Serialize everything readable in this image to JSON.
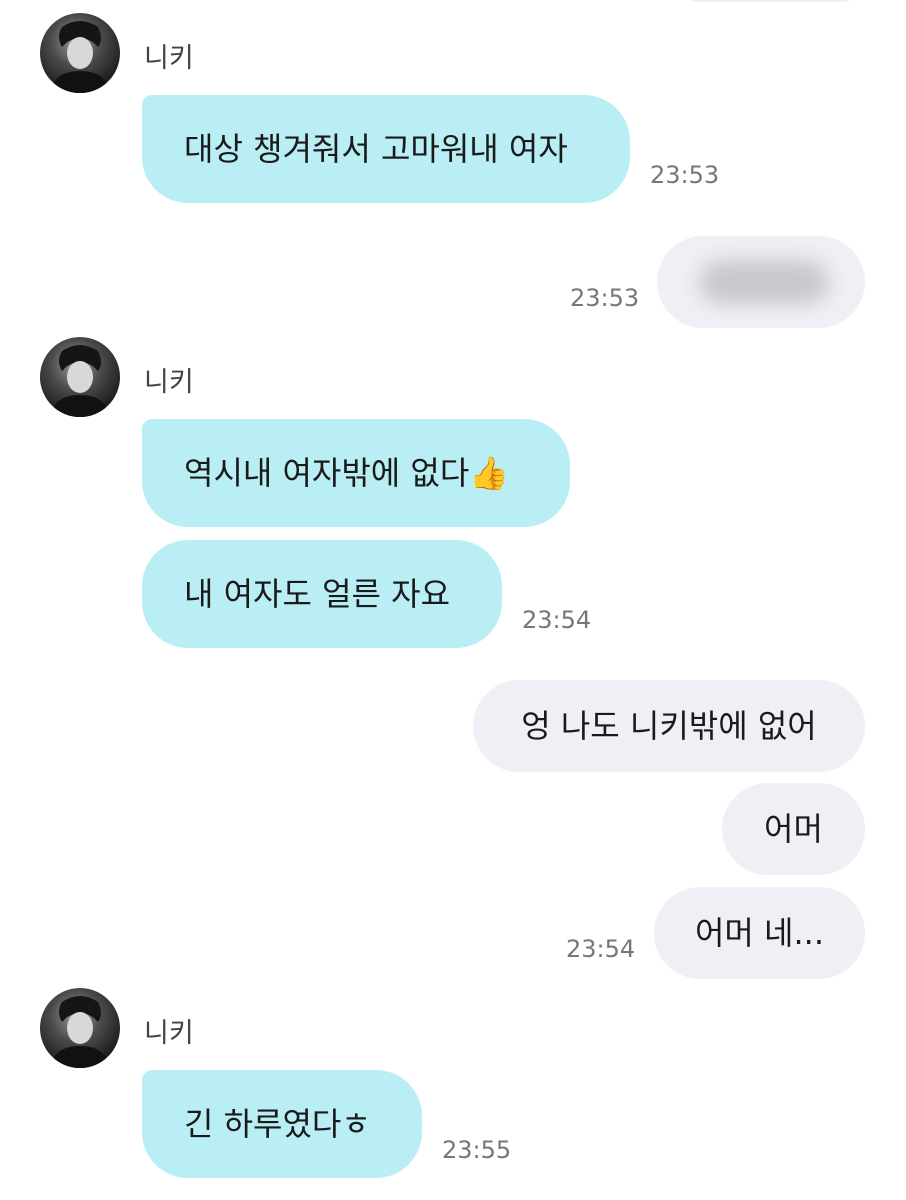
{
  "contact": {
    "name": "니키"
  },
  "messages": [
    {
      "text": "대상 챙겨줘서 고마워내 여자",
      "time": "23:53"
    },
    {
      "time": "23:53"
    },
    {
      "text": "역시내 여자밖에 없다",
      "emoji": "👍"
    },
    {
      "text": "내 여자도 얼른 자요",
      "time": "23:54"
    },
    {
      "text": "엉 나도 니키밖에 없어"
    },
    {
      "text": "어머"
    },
    {
      "text": "어머 네...",
      "time": "23:54"
    },
    {
      "text": "긴 하루였다ㅎ",
      "time": "23:55"
    }
  ],
  "colors": {
    "incoming_bubble": "#b9eef4",
    "outgoing_bubble": "#eef0f5",
    "timestamp": "#777777"
  },
  "icons": {
    "avatar": "profile-photo",
    "emoji": "thumbs-up"
  }
}
